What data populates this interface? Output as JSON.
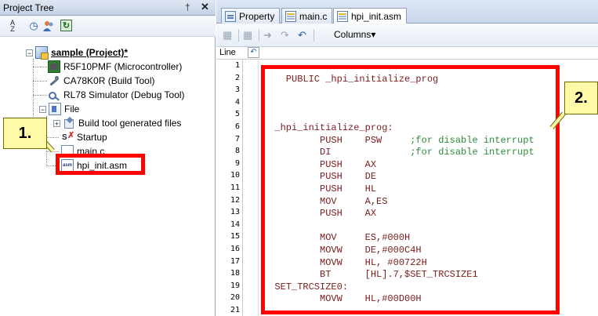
{
  "project_tree": {
    "title": "Project Tree",
    "pin_glyph": "†",
    "close_glyph": "✕",
    "toolbar": {
      "sort_icon": "sort-az-icon",
      "history_icon": "history-icon",
      "member_icon": "members-icon",
      "refresh_icon": "refresh-icon"
    },
    "items": [
      {
        "label": "sample (Project)*",
        "icon": "project-icon",
        "expander": "−"
      },
      {
        "label": "R5F10PMF (Microcontroller)",
        "icon": "microcontroller-icon"
      },
      {
        "label": "CA78K0R (Build Tool)",
        "icon": "build-tool-icon"
      },
      {
        "label": "RL78 Simulator (Debug Tool)",
        "icon": "debug-tool-icon"
      },
      {
        "label": "File",
        "icon": "file-folder-icon",
        "expander": "−"
      },
      {
        "label": "Build tool generated files",
        "icon": "generated-files-icon",
        "expander": "+"
      },
      {
        "label": "Startup",
        "icon": "startup-icon"
      },
      {
        "label": "main.c",
        "icon": "c-file-icon"
      },
      {
        "label": "hpi_init.asm",
        "icon": "asm-file-icon",
        "icon_text": "asm"
      }
    ]
  },
  "annotations": {
    "callout_1": "1.",
    "callout_2": "2."
  },
  "editor": {
    "tabs": [
      {
        "label": "Property",
        "icon": "property-icon",
        "active": false
      },
      {
        "label": "main.c",
        "icon": "document-icon",
        "active": false
      },
      {
        "label": "hpi_init.asm",
        "icon": "document-icon",
        "active": true
      }
    ],
    "toolbar": {
      "columns_label": "Columns",
      "dropdown_glyph": "▾"
    },
    "line_header": "Line",
    "marker_glyph": "↶",
    "lines": [
      {
        "num": "1",
        "code": "",
        "comment": ""
      },
      {
        "num": "2",
        "code": "    PUBLIC _hpi_initialize_prog",
        "comment": ""
      },
      {
        "num": "3",
        "code": "",
        "comment": ""
      },
      {
        "num": "4",
        "code": "",
        "comment": ""
      },
      {
        "num": "5",
        "code": "",
        "comment": ""
      },
      {
        "num": "6",
        "code": "  _hpi_initialize_prog:",
        "comment": ""
      },
      {
        "num": "7",
        "code": "          PUSH    PSW     ",
        "comment": ";for disable interrupt"
      },
      {
        "num": "8",
        "code": "          DI              ",
        "comment": ";for disable interrupt"
      },
      {
        "num": "9",
        "code": "          PUSH    AX",
        "comment": ""
      },
      {
        "num": "10",
        "code": "          PUSH    DE",
        "comment": ""
      },
      {
        "num": "11",
        "code": "          PUSH    HL",
        "comment": ""
      },
      {
        "num": "12",
        "code": "          MOV     A,ES",
        "comment": ""
      },
      {
        "num": "13",
        "code": "          PUSH    AX",
        "comment": ""
      },
      {
        "num": "14",
        "code": "",
        "comment": ""
      },
      {
        "num": "15",
        "code": "          MOV     ES,#000H",
        "comment": ""
      },
      {
        "num": "16",
        "code": "          MOVW    DE,#000C4H",
        "comment": ""
      },
      {
        "num": "17",
        "code": "          MOVW    HL, #00722H",
        "comment": ""
      },
      {
        "num": "18",
        "code": "          BT      [HL].7,$SET_TRCSIZE1",
        "comment": ""
      },
      {
        "num": "19",
        "code": "  SET_TRCSIZE0:",
        "comment": ""
      },
      {
        "num": "20",
        "code": "          MOVW    HL,#00D00H",
        "comment": ""
      },
      {
        "num": "21",
        "code": "",
        "comment": ""
      }
    ]
  },
  "colors": {
    "highlight_box": "#ff0000",
    "callout_fill": "#fff9a8",
    "code_text": "#7a1c1c",
    "comment_text": "#2e8b3a"
  }
}
